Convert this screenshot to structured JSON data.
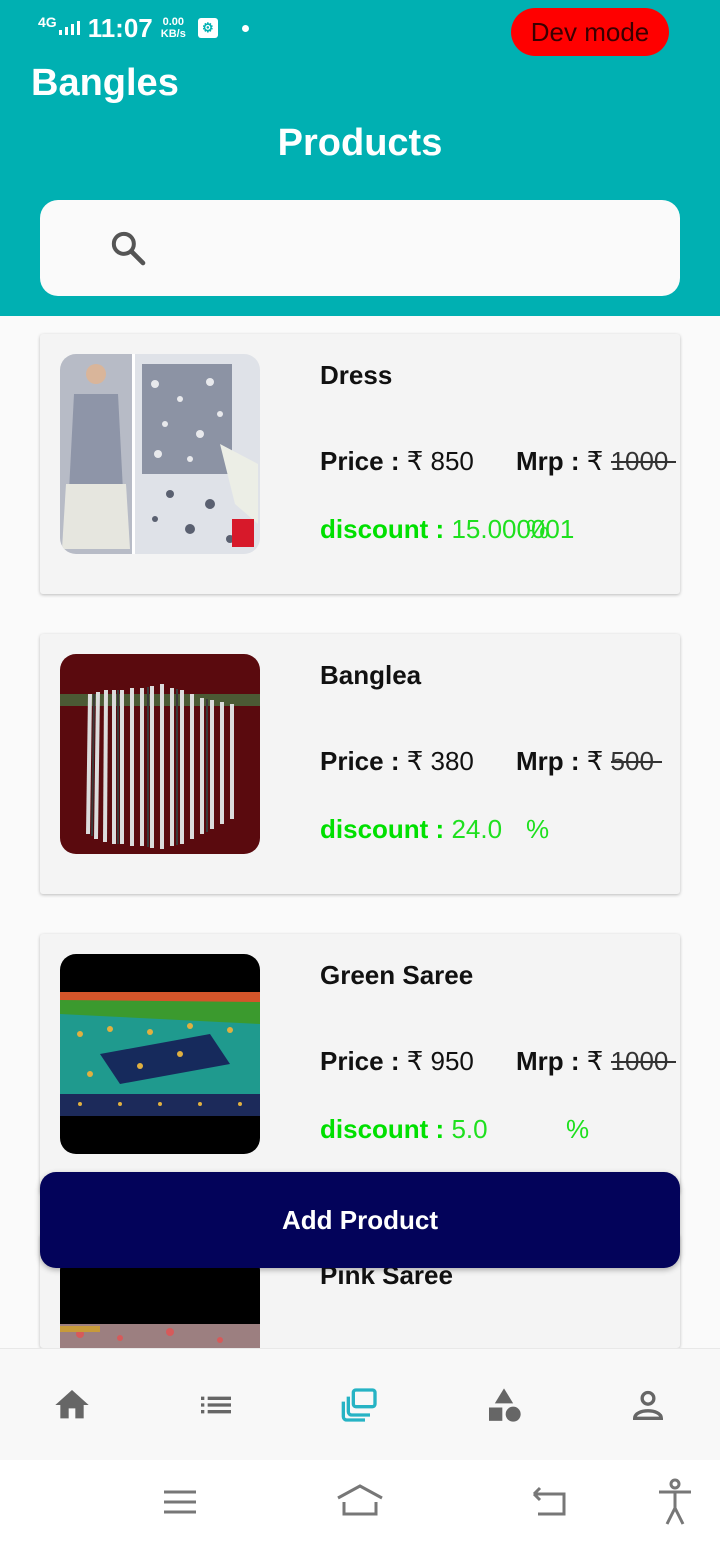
{
  "status_bar": {
    "network": "4G",
    "time": "11:07",
    "speed_value": "0.00",
    "speed_unit": "KB/s",
    "usb_icon": "usb-debug-icon"
  },
  "dev_badge": "Dev mode",
  "app_title": "Bangles",
  "page_title": "Products",
  "search": {
    "icon": "search-icon",
    "value": ""
  },
  "products": [
    {
      "name": "Dress",
      "price_label": "Price : ",
      "price": "₹ 850",
      "mrp_label": "Mrp : ",
      "currency": "₹ ",
      "mrp": "1000",
      "discount_label": "discount : ",
      "discount": "15.000001",
      "percent": "%"
    },
    {
      "name": "Banglea",
      "price_label": "Price : ",
      "price": "₹ 380",
      "mrp_label": "Mrp : ",
      "currency": "₹ ",
      "mrp": "500",
      "discount_label": "discount : ",
      "discount": "24.0",
      "percent": "%"
    },
    {
      "name": "Green Saree",
      "price_label": "Price : ",
      "price": "₹ 950",
      "mrp_label": "Mrp : ",
      "currency": "₹ ",
      "mrp": "1000",
      "discount_label": "discount : ",
      "discount": "5.0",
      "percent": "%"
    },
    {
      "name": "Pink Saree"
    }
  ],
  "add_button": "Add Product",
  "bottom_nav": [
    {
      "icon": "home-icon",
      "active": false
    },
    {
      "icon": "list-icon",
      "active": false
    },
    {
      "icon": "products-icon",
      "active": true
    },
    {
      "icon": "categories-icon",
      "active": false
    },
    {
      "icon": "profile-icon",
      "active": false
    }
  ],
  "colors": {
    "header": "#00b0b2",
    "dev_badge": "#ff0000",
    "add_button": "#03035a",
    "discount": "#00e000",
    "nav_active": "#26b3c4",
    "nav_inactive": "#666666"
  }
}
